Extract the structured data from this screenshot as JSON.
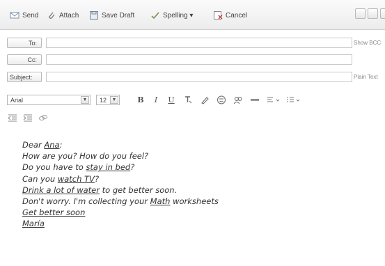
{
  "toolbar": {
    "send": "Send",
    "attach": "Attach",
    "save_draft": "Save Draft",
    "spelling": "Spelling ▾",
    "cancel": "Cancel"
  },
  "fields": {
    "to_label": "To:",
    "cc_label": "Cc:",
    "subject_label": "Subject:",
    "show_bcc": "Show BCC",
    "plain_text": "Plain Text"
  },
  "format": {
    "font": "Arial",
    "size": "12",
    "bold": "B",
    "italic": "I",
    "underline": "U"
  },
  "message": {
    "greeting_prefix": "Dear ",
    "name": "Ana",
    "greeting_suffix": ":",
    "l2": "How are you? How do you feel?",
    "l3_prefix": "Do you have to ",
    "l3_u": "stay in bed",
    "l3_suffix": "?",
    "l4_prefix": "Can you ",
    "l4_u": "watch TV",
    "l4_suffix": "?",
    "l5_u": "Drink a lot of water",
    "l5_suffix": " to get better soon.",
    "l6_prefix": "Don't worry. I'm collecting your ",
    "l6_u": "Math",
    "l6_suffix": " worksheets",
    "l7_u": "Get better soon",
    "l8_u": "María"
  }
}
